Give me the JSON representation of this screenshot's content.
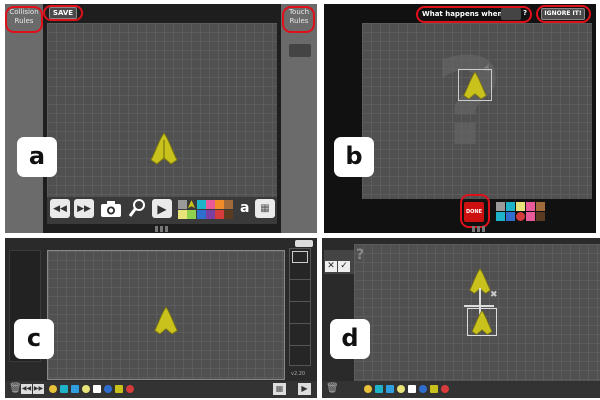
{
  "panel_a": {
    "label": "a",
    "save": "SAVE",
    "collision_rules": "Collision Rules",
    "touch_rules": "Touch Rules",
    "text_tool": "a"
  },
  "panel_b": {
    "label": "b",
    "prompt": "What happens when",
    "qmark": "?",
    "ignore": "IGNORE IT!",
    "done": "DONE"
  },
  "panel_c": {
    "label": "c",
    "version": "v2.20"
  },
  "panel_d": {
    "label": "d",
    "help": "?"
  },
  "colors": {
    "highlight": "#e0101a",
    "ship": "#c9c21c",
    "grid": "#505050",
    "done_button": "#cc1010"
  },
  "palette_a": [
    "#e8e47a",
    "#8fd14f",
    "#1fb3c9",
    "#2f6ecf",
    "#9a9a9a",
    "#e85a9a",
    "#f28c28",
    "#a06a3a",
    "#7a3fa0",
    "#2aa05a",
    "#d63c3c",
    "#5a3a20"
  ],
  "icons": [
    "rewind-icon",
    "fast-forward-icon",
    "camera-icon",
    "magnifier-icon",
    "play-icon",
    "ship-sprite",
    "text-tool-icon",
    "trash-icon",
    "hand-pointer-icon"
  ]
}
